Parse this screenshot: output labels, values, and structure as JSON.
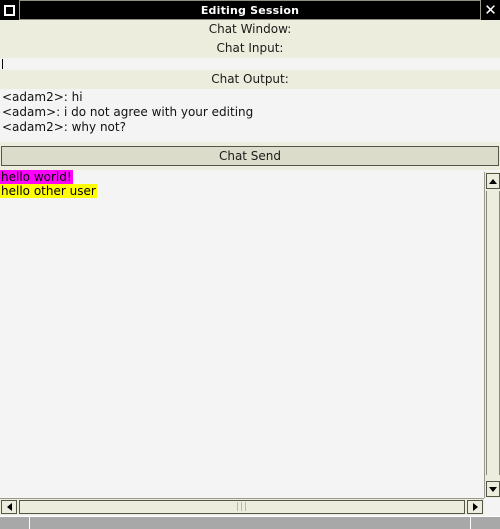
{
  "window": {
    "title": "Editing Session",
    "menu_icon": "maximize-square-icon",
    "close_icon": "close-icon",
    "close_glyph": "✕"
  },
  "labels": {
    "chat_window": "Chat Window:",
    "chat_input": "Chat Input:",
    "chat_output": "Chat Output:"
  },
  "chat_input": {
    "value": "",
    "placeholder": ""
  },
  "chat_output": {
    "lines": [
      "<adam2>: hi",
      "<adam>: i do not agree with your editing",
      "<adam2>: why not?"
    ]
  },
  "toolbar": {
    "send_label": "Chat Send"
  },
  "canvas": {
    "lines": [
      {
        "text": "hello world!",
        "background": "#ff00ff",
        "color": "#000000"
      },
      {
        "text": "hello other user",
        "background": "#ffff00",
        "color": "#000000"
      }
    ]
  },
  "scrollbars": {
    "vertical": {
      "up_icon": "arrow-up-icon",
      "down_icon": "arrow-down-icon"
    },
    "horizontal": {
      "left_icon": "arrow-left-icon",
      "right_icon": "arrow-right-icon",
      "grip": "|||"
    }
  },
  "statusbar": {
    "cells": [
      "",
      "",
      ""
    ]
  },
  "colors": {
    "titlebar_bg": "#000000",
    "titlebar_text": "#ffffff",
    "band_bg": "#eceddd",
    "canvas_bg": "#f4f4f4",
    "button_bg": "#dcdccb",
    "status_bg": "#a8a8a8",
    "highlight_magenta": "#ff00ff",
    "highlight_yellow": "#ffff00"
  }
}
